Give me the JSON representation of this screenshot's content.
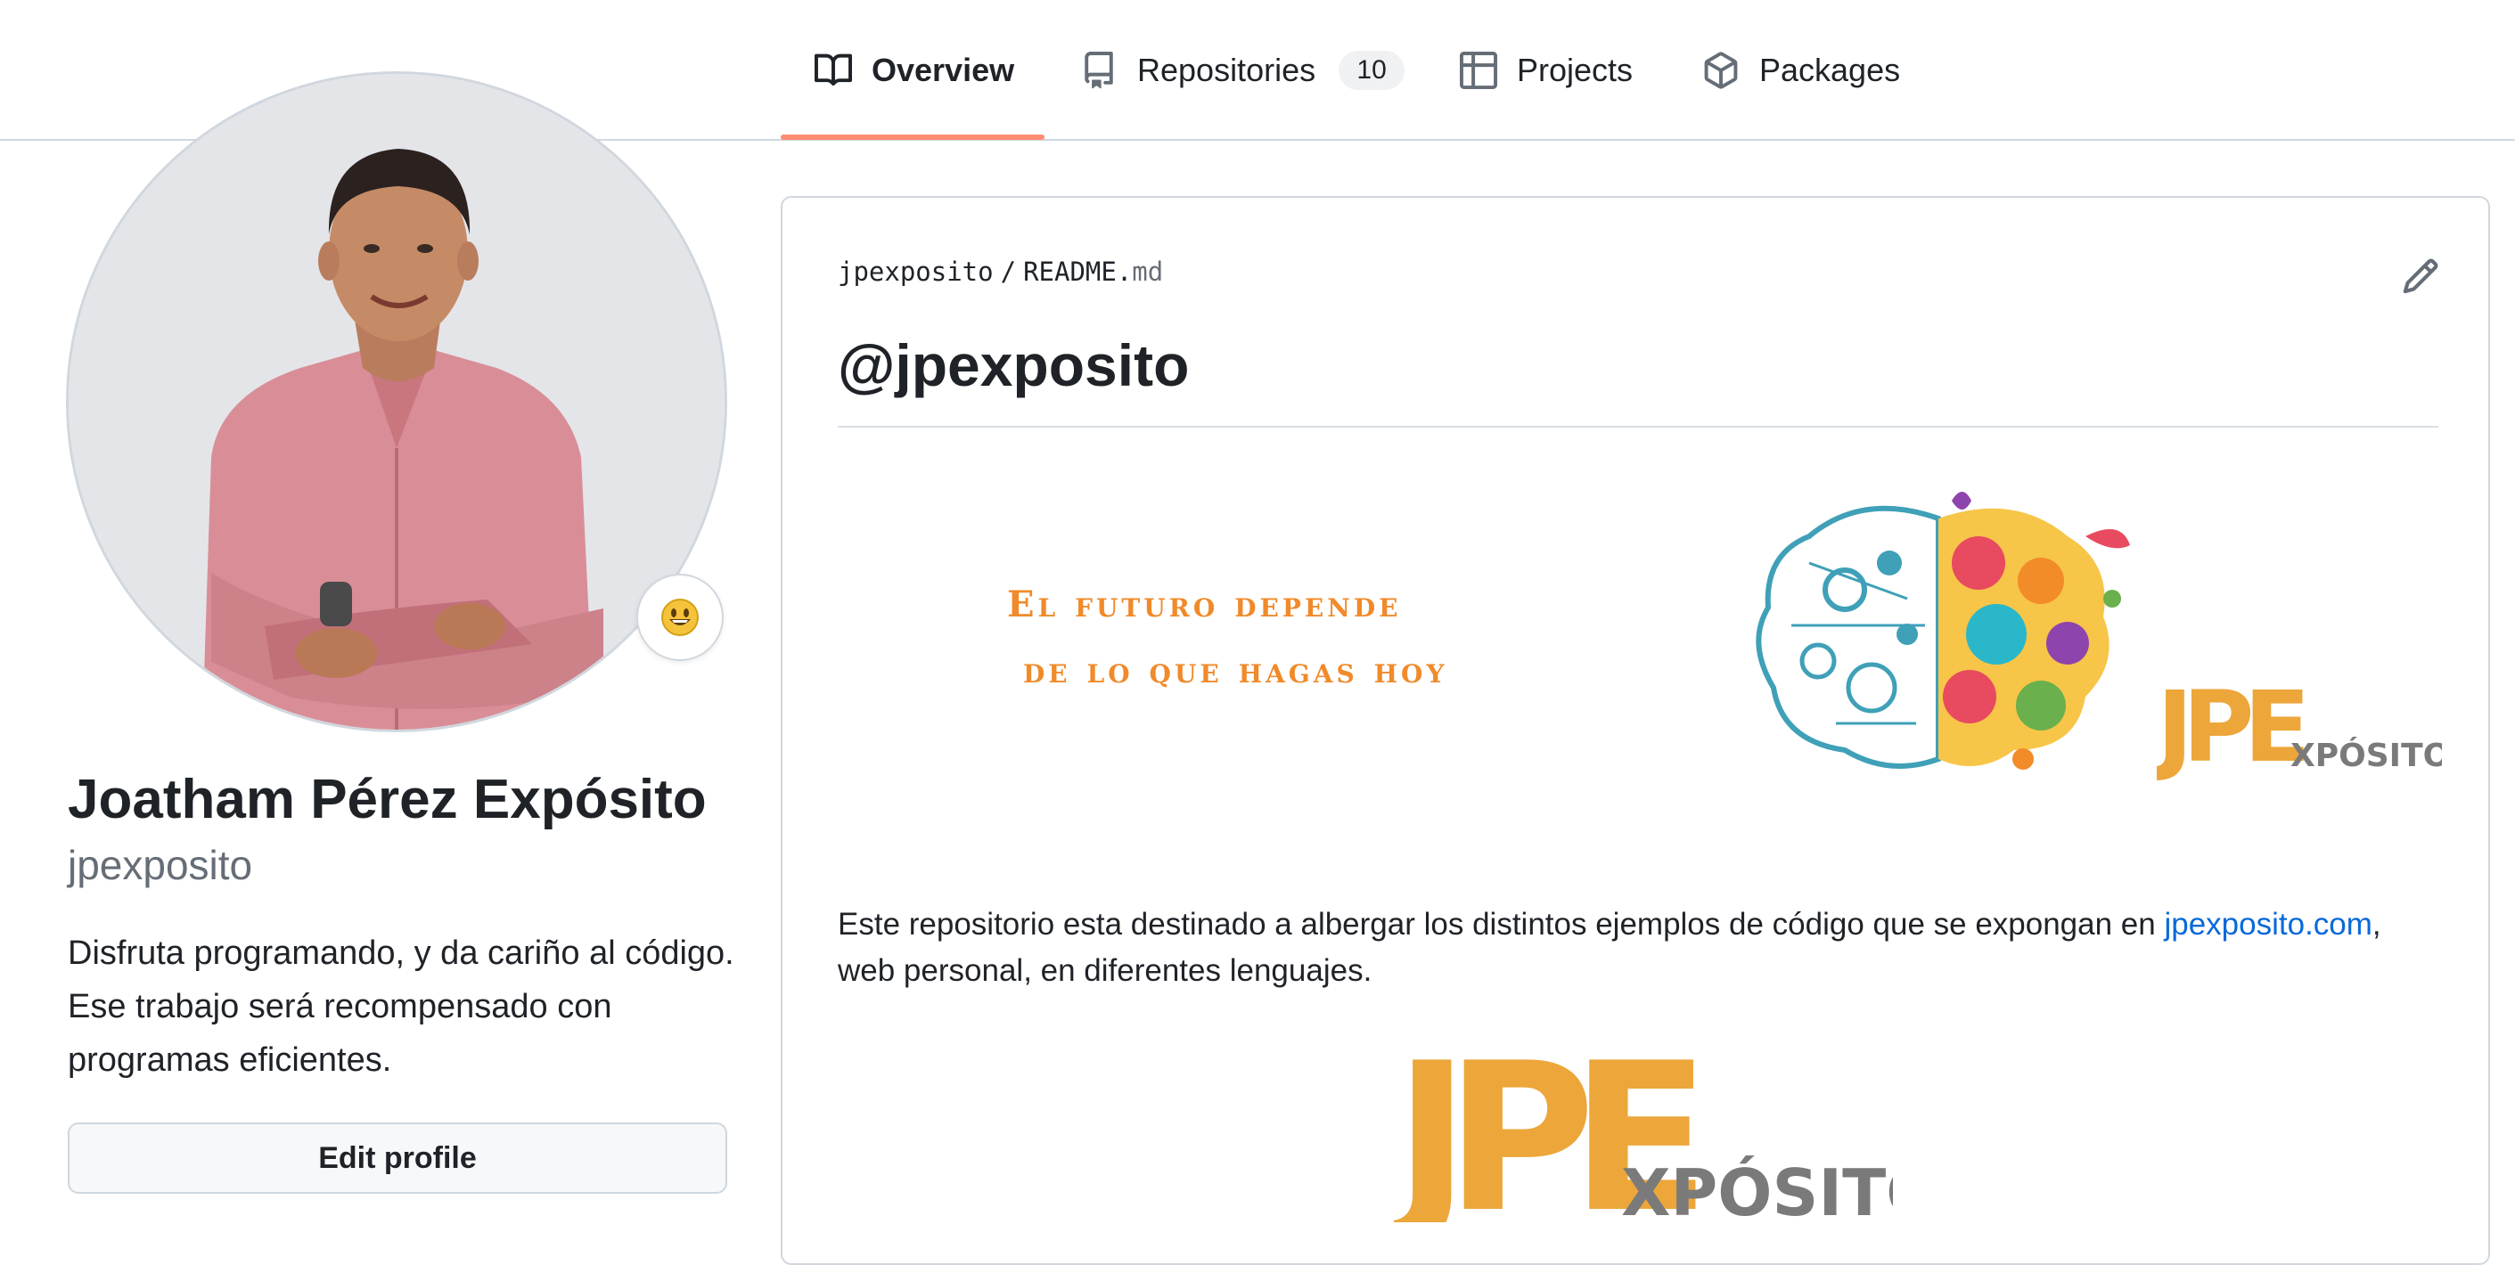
{
  "nav": {
    "tabs": [
      {
        "label": "Overview",
        "icon": "book-icon",
        "active": true
      },
      {
        "label": "Repositories",
        "icon": "repo-icon",
        "count": "10"
      },
      {
        "label": "Projects",
        "icon": "table-icon"
      },
      {
        "label": "Packages",
        "icon": "package-icon"
      }
    ]
  },
  "profile": {
    "name": "Joatham Pérez Expósito",
    "login": "jpexposito",
    "bio": "Disfruta programando, y da cariño al código. Ese trabajo será recompensado con programas eficientes.",
    "status_emoji": "😃",
    "edit_label": "Edit profile"
  },
  "readme": {
    "owner": "jpexposito",
    "separator": "/",
    "file_base": "README.",
    "file_ext": "md",
    "heading": "@jpexposito",
    "banner_line1": "El futuro depende",
    "banner_line2": "de lo que hagas hoy",
    "banner_logo_mark": "JPE",
    "banner_logo_text": "XPÓSITO",
    "para_before": "Este repositorio esta destinado a albergar los distintos ejemplos de código que se expongan en ",
    "para_link": "jpexposito.com",
    "para_after": ", web personal, en diferentes lenguajes.",
    "logo_mark": "JPE",
    "logo_text": "XPÓSITO"
  },
  "colors": {
    "accent_underline": "#fd8c73",
    "link": "#0969da",
    "banner_orange": "#f08a2a",
    "logo_gold": "#eca63a",
    "logo_gray": "#7a7a7a"
  }
}
